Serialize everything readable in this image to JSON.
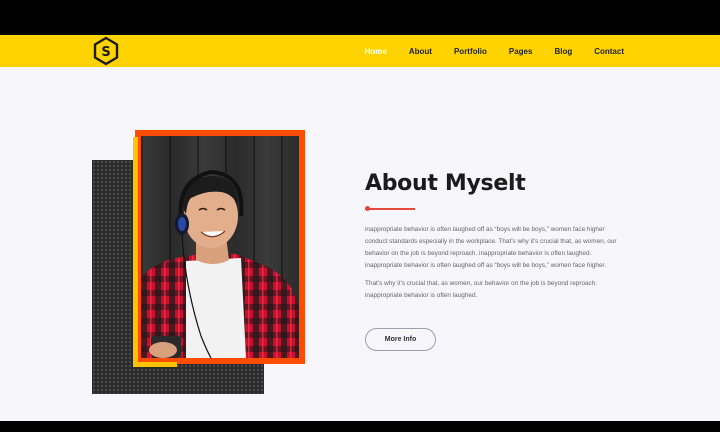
{
  "brand": {
    "logo_letter": "S"
  },
  "nav": {
    "items": [
      {
        "label": "Home",
        "active": true
      },
      {
        "label": "About",
        "active": false
      },
      {
        "label": "Portfolio",
        "active": false
      },
      {
        "label": "Pages",
        "active": false
      },
      {
        "label": "Blog",
        "active": false
      },
      {
        "label": "Contact",
        "active": false
      }
    ]
  },
  "about": {
    "heading": "About Myselt",
    "paragraph1": "inappropriate behavior is often laughed off as “boys will be boys,” women face higher conduct standards especially in the workplace. That’s why it’s crucial that, as women, our behavior on the job is beyond reproach. inappropriate behavior is often laughed. inappropriate behavior is often laughed off as “boys will be boys,” women face higher.",
    "paragraph2": "That’s why it’s crucial that, as women, our behavior on the job is beyond reproach. inappropriate behavior is often laughed.",
    "button_label": "More Info"
  },
  "colors": {
    "navbar": "#ffd300",
    "accent": "#ff4d00",
    "underline": "#e24a3d",
    "page_bg": "#f6f6fb"
  }
}
